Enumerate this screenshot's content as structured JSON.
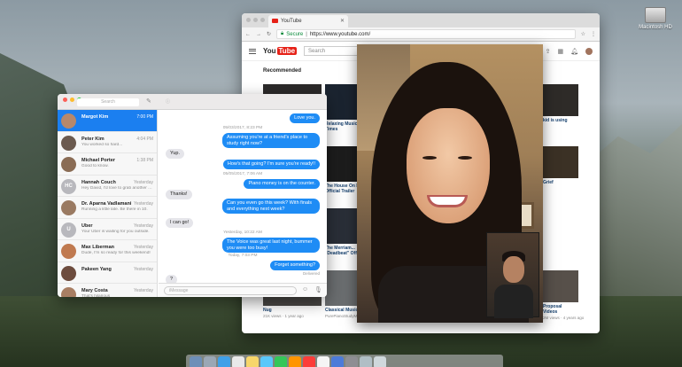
{
  "desktop": {
    "hard_drive_label": "Macintosh HD"
  },
  "chrome": {
    "tab_title": "YouTube",
    "secure_label": "Secure",
    "url": "https://www.youtube.com/",
    "youtube": {
      "logo_you": "You",
      "logo_tube": "Tube",
      "search_placeholder": "Search",
      "section_title": "Recommended",
      "videos": [
        {
          "title": "Relaxing Music from...",
          "subtitle": "Times",
          "meta": ""
        },
        {
          "title": "The House On Po...",
          "subtitle": "Official Trailer",
          "meta": ""
        },
        {
          "title": "The Merriam...",
          "subtitle": "\"Deadbeat\" Off",
          "meta": ""
        },
        {
          "title": "Classical Music f...",
          "subtitle": "Classical Studying",
          "meta": "PurePianoStudyMusic"
        },
        {
          "title": "Nug",
          "subtitle": "",
          "meta": "21K views · 1 year ago"
        },
        {
          "title": "kid is using",
          "subtitle": "",
          "meta": ""
        },
        {
          "title": "Grief",
          "subtitle": "",
          "meta": ""
        },
        {
          "title": "Proposal",
          "subtitle": "Videos",
          "meta": "2M views · 4 years ago"
        }
      ]
    }
  },
  "messages": {
    "search_placeholder": "Search",
    "input_placeholder": "iMessage",
    "conversations": [
      {
        "name": "Margot Kim",
        "time": "7:00 PM",
        "preview": "",
        "initials": "",
        "avatar_color": "#b6886b"
      },
      {
        "name": "Peter Kim",
        "time": "4:04 PM",
        "preview": "You worked so hard...",
        "initials": "",
        "avatar_color": "#6b5a4f"
      },
      {
        "name": "Michael Porter",
        "time": "1:38 PM",
        "preview": "Good to know.",
        "initials": "",
        "avatar_color": "#8a6c55"
      },
      {
        "name": "Hannah Couch",
        "time": "Yesterday",
        "preview": "Hey David, I'd love to grab another drink if you're free...",
        "initials": "HC",
        "avatar_color": "#b8b8bd"
      },
      {
        "name": "Dr. Aparna Vadlamani",
        "time": "Yesterday",
        "preview": "Running a little late. Be there in 10.",
        "initials": "",
        "avatar_color": "#9a7a62"
      },
      {
        "name": "Uber",
        "time": "Yesterday",
        "preview": "Your Uber is waiting for you outside.",
        "initials": "U",
        "avatar_color": "#b8b8bd"
      },
      {
        "name": "Max Liberman",
        "time": "Yesterday",
        "preview": "Dude, I'm so ready for this weekend!",
        "initials": "",
        "avatar_color": "#c07a50"
      },
      {
        "name": "Pakeen Yang",
        "time": "Yesterday",
        "preview": "",
        "initials": "",
        "avatar_color": "#6d4c3e"
      },
      {
        "name": "Mary Costa",
        "time": "Yesterday",
        "preview": "That's hilarious",
        "initials": "",
        "avatar_color": "#a87e63"
      }
    ],
    "thread": [
      {
        "kind": "me",
        "text": "Love you."
      },
      {
        "kind": "stamp",
        "text": "05/03/2017, 8:23 PM"
      },
      {
        "kind": "me",
        "text": "Assuming you're at a friend's place to study right now?"
      },
      {
        "kind": "them",
        "text": "Yup."
      },
      {
        "kind": "me",
        "text": "How's that going? I'm sure you're ready!!"
      },
      {
        "kind": "stamp",
        "text": "05/05/2017, 7:06 AM"
      },
      {
        "kind": "me",
        "text": "Piano money is on the counter."
      },
      {
        "kind": "them",
        "text": "Thanks!"
      },
      {
        "kind": "me",
        "text": "Can you even go this week? With finals and everything next week?"
      },
      {
        "kind": "them",
        "text": "I can go!"
      },
      {
        "kind": "stamp",
        "text": "Yesterday, 10:22 AM"
      },
      {
        "kind": "me",
        "text": "The Voice was great last night, bummer you were too busy!"
      },
      {
        "kind": "stamp",
        "text": "Today, 7:03 PM"
      },
      {
        "kind": "me",
        "text": "Forget something?"
      },
      {
        "kind": "delivered",
        "text": "Delivered"
      },
      {
        "kind": "them",
        "text": "?"
      }
    ]
  },
  "colors": {
    "imessage_blue": "#1e8cf5",
    "selection_blue": "#1b7ff0",
    "youtube_red": "#e62117"
  }
}
